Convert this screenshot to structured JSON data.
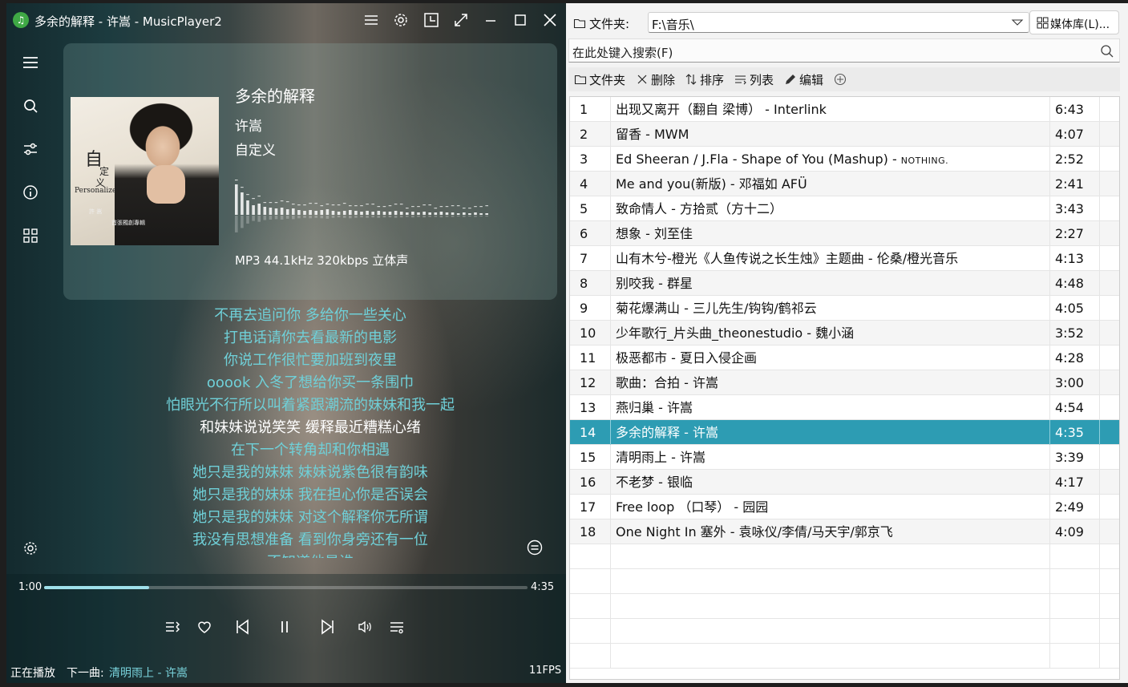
{
  "window": {
    "title": "多余的解释 - 许嵩 - MusicPlayer2"
  },
  "now_playing": {
    "title": "多余的解释",
    "artist": "许嵩",
    "album": "自定义",
    "format": "MP3 44.1kHz 320kbps 立体声",
    "current_time": "1:00",
    "total_time": "4:35",
    "progress_fraction": 0.218
  },
  "cover": {
    "lines": [
      "自",
      "定",
      "义",
      "Personalize",
      "許 嵩",
      "首張獨創專輯"
    ]
  },
  "lyrics": [
    "不再去追问你 多给你一些关心",
    "打电话请你去看最新的电影",
    "你说工作很忙要加班到夜里",
    "ooook 入冬了想给你买一条围巾",
    "怕眼光不行所以叫着紧跟潮流的妹妹和我一起",
    "和妹妹说说笑笑 缓释最近糟糕心绪",
    "在下一个转角却和你相遇",
    "她只是我的妹妹 妹妹说紫色很有韵味",
    "她只是我的妹妹 我在担心你是否误会",
    "她只是我的妹妹 对这个解释你无所谓",
    "我没有思想准备 看到你身旁还有一位",
    "不知道他是谁"
  ],
  "current_lyric_index": 5,
  "status": {
    "now_playing_label": "正在播放",
    "next_label": "下一曲:",
    "next_song": "清明雨上 - 许嵩",
    "fps": "11FPS"
  },
  "playlist": {
    "folder_label": "文件夹:",
    "folder_value": "F:\\音乐\\",
    "library_button": "媒体库(L)...",
    "search_placeholder": "在此处键入搜索(F)",
    "toolbar": [
      "文件夹",
      "删除",
      "排序",
      "列表",
      "编辑"
    ],
    "selected_index": 13,
    "rows": [
      {
        "idx": "1",
        "name": "出现又离开（翻自 梁博） - Interlink",
        "dur": "6:43"
      },
      {
        "idx": "2",
        "name": "留香 - MWM",
        "dur": "4:07"
      },
      {
        "idx": "3",
        "name": "Ed Sheeran / J.Fla - Shape of You (Mashup) - ",
        "name_suffix": "NOTHING.",
        "dur": "2:52"
      },
      {
        "idx": "4",
        "name": "Me and you(新版) - 邓福如 AFÜ",
        "dur": "2:41"
      },
      {
        "idx": "5",
        "name": "致命情人 - 方拾贰（方十二）",
        "dur": "3:43"
      },
      {
        "idx": "6",
        "name": "想象 - 刘至佳",
        "dur": "2:27"
      },
      {
        "idx": "7",
        "name": "山有木兮-橙光《人鱼传说之长生烛》主题曲 - 伦桑/橙光音乐",
        "dur": "4:13"
      },
      {
        "idx": "8",
        "name": "别咬我 - 群星",
        "dur": "4:48"
      },
      {
        "idx": "9",
        "name": "菊花爆满山 - 三儿先生/钩钩/鹤祁云",
        "dur": "4:05"
      },
      {
        "idx": "10",
        "name": "少年歌行_片头曲_theonestudio - 魏小涵",
        "dur": "3:52"
      },
      {
        "idx": "11",
        "name": "极恶都市 - 夏日入侵企画",
        "dur": "4:28"
      },
      {
        "idx": "12",
        "name": "歌曲：合拍 - 许嵩",
        "dur": "3:00"
      },
      {
        "idx": "13",
        "name": "燕归巢 - 许嵩",
        "dur": "4:54"
      },
      {
        "idx": "14",
        "name": "多余的解释 - 许嵩",
        "dur": "4:35"
      },
      {
        "idx": "15",
        "name": "清明雨上 - 许嵩",
        "dur": "3:39"
      },
      {
        "idx": "16",
        "name": "不老梦 - 银临",
        "dur": "4:17"
      },
      {
        "idx": "17",
        "name": "Free loop （口琴） - 园园",
        "dur": "2:49"
      },
      {
        "idx": "18",
        "name": "One Night In 塞外 - 袁咏仪/李倩/马天宇/郭京飞",
        "dur": "4:09"
      }
    ]
  },
  "colors": {
    "accent": "#2d9cb3",
    "lyric": "#6fd0d8",
    "lyric_current": "#ffffff"
  }
}
